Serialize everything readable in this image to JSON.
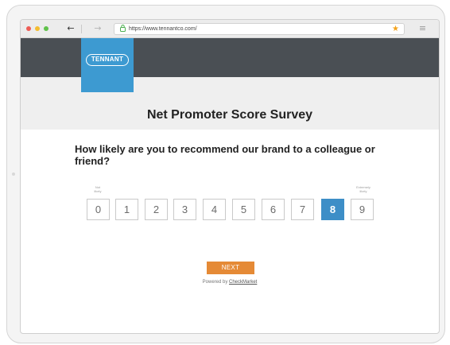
{
  "browser": {
    "url": "https://www.tennantco.com/",
    "back_glyph": "←",
    "forward_glyph": "→",
    "lock_glyph": "🔒",
    "bookmark_glyph": "★",
    "menu_glyph": "≡",
    "icons": {
      "back": "arrow-left-icon",
      "forward": "arrow-right-icon",
      "lock": "lock-icon",
      "bookmark": "star-icon",
      "menu": "hamburger-menu-icon"
    }
  },
  "brand": {
    "logo_text": "TENNANT",
    "logo_bg": "#3d9ad1",
    "header_bg": "#4a4f54"
  },
  "survey": {
    "title": "Net Promoter Score Survey",
    "question": "How likely are you to recommend our brand to a colleague or friend?",
    "low_label_line1": "Not",
    "low_label_line2": "likely",
    "high_label_line1": "Extremely",
    "high_label_line2": "likely",
    "scores": [
      "0",
      "1",
      "2",
      "3",
      "4",
      "5",
      "6",
      "7",
      "8",
      "9"
    ],
    "selected_score": "8",
    "selected_color": "#3d8ec7"
  },
  "footer": {
    "next_label": "NEXT",
    "next_color": "#e58a36",
    "powered_prefix": "Powered by ",
    "powered_link": "CheckMarket"
  }
}
